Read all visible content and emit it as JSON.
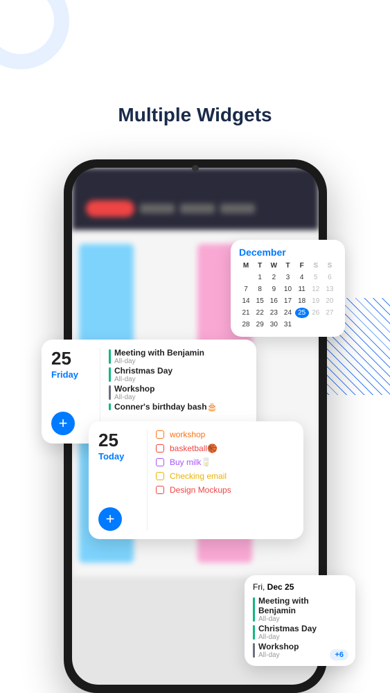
{
  "title": "Multiple Widgets",
  "calendar": {
    "month": "December",
    "headers": [
      "M",
      "T",
      "W",
      "T",
      "F",
      "S",
      "S"
    ],
    "days": [
      {
        "n": "",
        "cls": "empty"
      },
      {
        "n": "1"
      },
      {
        "n": "2"
      },
      {
        "n": "3"
      },
      {
        "n": "4"
      },
      {
        "n": "5",
        "cls": "weekend"
      },
      {
        "n": "6",
        "cls": "weekend"
      },
      {
        "n": "7"
      },
      {
        "n": "8"
      },
      {
        "n": "9"
      },
      {
        "n": "10"
      },
      {
        "n": "11"
      },
      {
        "n": "12",
        "cls": "weekend"
      },
      {
        "n": "13",
        "cls": "weekend"
      },
      {
        "n": "14"
      },
      {
        "n": "15"
      },
      {
        "n": "16"
      },
      {
        "n": "17"
      },
      {
        "n": "18"
      },
      {
        "n": "19",
        "cls": "weekend"
      },
      {
        "n": "20",
        "cls": "weekend"
      },
      {
        "n": "21"
      },
      {
        "n": "22"
      },
      {
        "n": "23"
      },
      {
        "n": "24"
      },
      {
        "n": "25",
        "cls": "today"
      },
      {
        "n": "26",
        "cls": "weekend"
      },
      {
        "n": "27",
        "cls": "weekend"
      },
      {
        "n": "28"
      },
      {
        "n": "29"
      },
      {
        "n": "30"
      },
      {
        "n": "31"
      },
      {
        "n": "",
        "cls": "empty"
      },
      {
        "n": "",
        "cls": "empty"
      },
      {
        "n": "",
        "cls": "empty"
      }
    ]
  },
  "events_widget": {
    "day": "25",
    "weekday": "Friday",
    "events": [
      {
        "title": "Meeting with Benjamin",
        "sub": "All-day",
        "color": "#10b981"
      },
      {
        "title": "Christmas Day",
        "sub": "All-day",
        "color": "#10b981"
      },
      {
        "title": "Workshop",
        "sub": "All-day",
        "color": "#6b7280"
      },
      {
        "title": "Conner's birthday bash🎂",
        "sub": "",
        "color": "#10b981"
      }
    ]
  },
  "todo_widget": {
    "day": "25",
    "weekday": "Today",
    "items": [
      {
        "text": "workshop",
        "color": "#f97316"
      },
      {
        "text": "basketball🏀",
        "color": "#ef4444"
      },
      {
        "text": "Buy milk🥛",
        "color": "#a855f7"
      },
      {
        "text": "Checking email",
        "color": "#eab308"
      },
      {
        "text": "Design Mockups",
        "color": "#ef4444"
      }
    ]
  },
  "small_widget": {
    "date_prefix": "Fri, ",
    "date_bold": "Dec 25",
    "events": [
      {
        "title": "Meeting with Benjamin",
        "sub": "All-day",
        "color": "#10b981"
      },
      {
        "title": "Christmas Day",
        "sub": "All-day",
        "color": "#10b981"
      },
      {
        "title": "Workshop",
        "sub": "All-day",
        "color": "#6b7280"
      }
    ],
    "more": "+6"
  },
  "add_label": "+"
}
